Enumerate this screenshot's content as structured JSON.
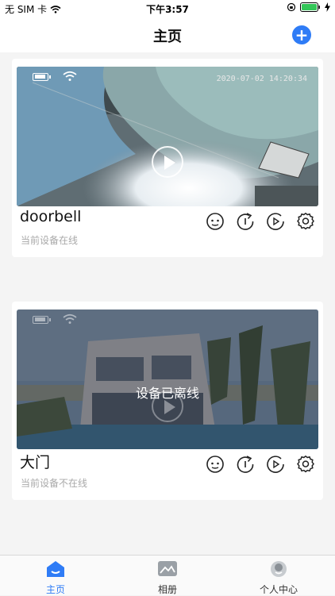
{
  "status_bar": {
    "carrier": "无 SIM 卡",
    "time": "下午3:57"
  },
  "nav": {
    "title": "主页"
  },
  "devices": [
    {
      "name": "doorbell",
      "status": "当前设备在线",
      "timestamp": "2020-07-02 14:20:34",
      "online": true
    },
    {
      "name": "大门",
      "status": "当前设备不在线",
      "offline_label": "设备已离线",
      "online": false
    }
  ],
  "tabs": [
    {
      "label": "主页",
      "icon": "home-icon",
      "active": true
    },
    {
      "label": "相册",
      "icon": "album-icon",
      "active": false
    },
    {
      "label": "个人中心",
      "icon": "profile-icon",
      "active": false
    }
  ],
  "colors": {
    "accent": "#2f7cf6",
    "status_text": "#a9a9a9"
  }
}
